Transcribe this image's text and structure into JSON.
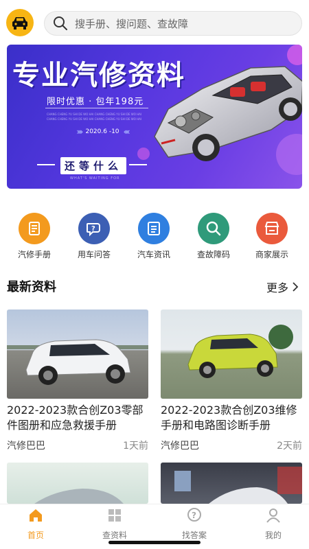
{
  "header": {
    "search_placeholder": "搜手册、搜问题、查故障"
  },
  "banner": {
    "title": "专业汽修资料",
    "promo": "限时优惠 · 包年198元",
    "small_text": "CHANG CHENG YU SHI DE WO HAI CHANG CHENG YU SHI DE WO HAI CHANG CHENG YU SHI DE WO HAI CHANG CHENG YU SHI DE WO HAI",
    "date": "2020.6 -10",
    "slogan": "还等什么",
    "slogan_en": "WHAT'S WAITING FOR"
  },
  "nav": {
    "items": [
      {
        "label": "汽修手册",
        "color": "#f39a1e"
      },
      {
        "label": "用车问答",
        "color": "#3c5fb4"
      },
      {
        "label": "汽车资讯",
        "color": "#2f7fe0"
      },
      {
        "label": "查故障码",
        "color": "#2f9a7a"
      },
      {
        "label": "商家展示",
        "color": "#ea5a3c"
      }
    ]
  },
  "section": {
    "title": "最新资料",
    "more": "更多"
  },
  "cards": [
    {
      "title": "2022-2023款合创Z03零部件图册和应急救援手册",
      "source": "汽修巴巴",
      "time": "1天前"
    },
    {
      "title": "2022-2023款合创Z03维修手册和电路图诊断手册",
      "source": "汽修巴巴",
      "time": "2天前"
    }
  ],
  "tabs": [
    {
      "label": "首页"
    },
    {
      "label": "查资料"
    },
    {
      "label": "找答案"
    },
    {
      "label": "我的"
    }
  ],
  "colors": {
    "accent": "#f39a1e",
    "logo_bg": "#f7b514"
  }
}
